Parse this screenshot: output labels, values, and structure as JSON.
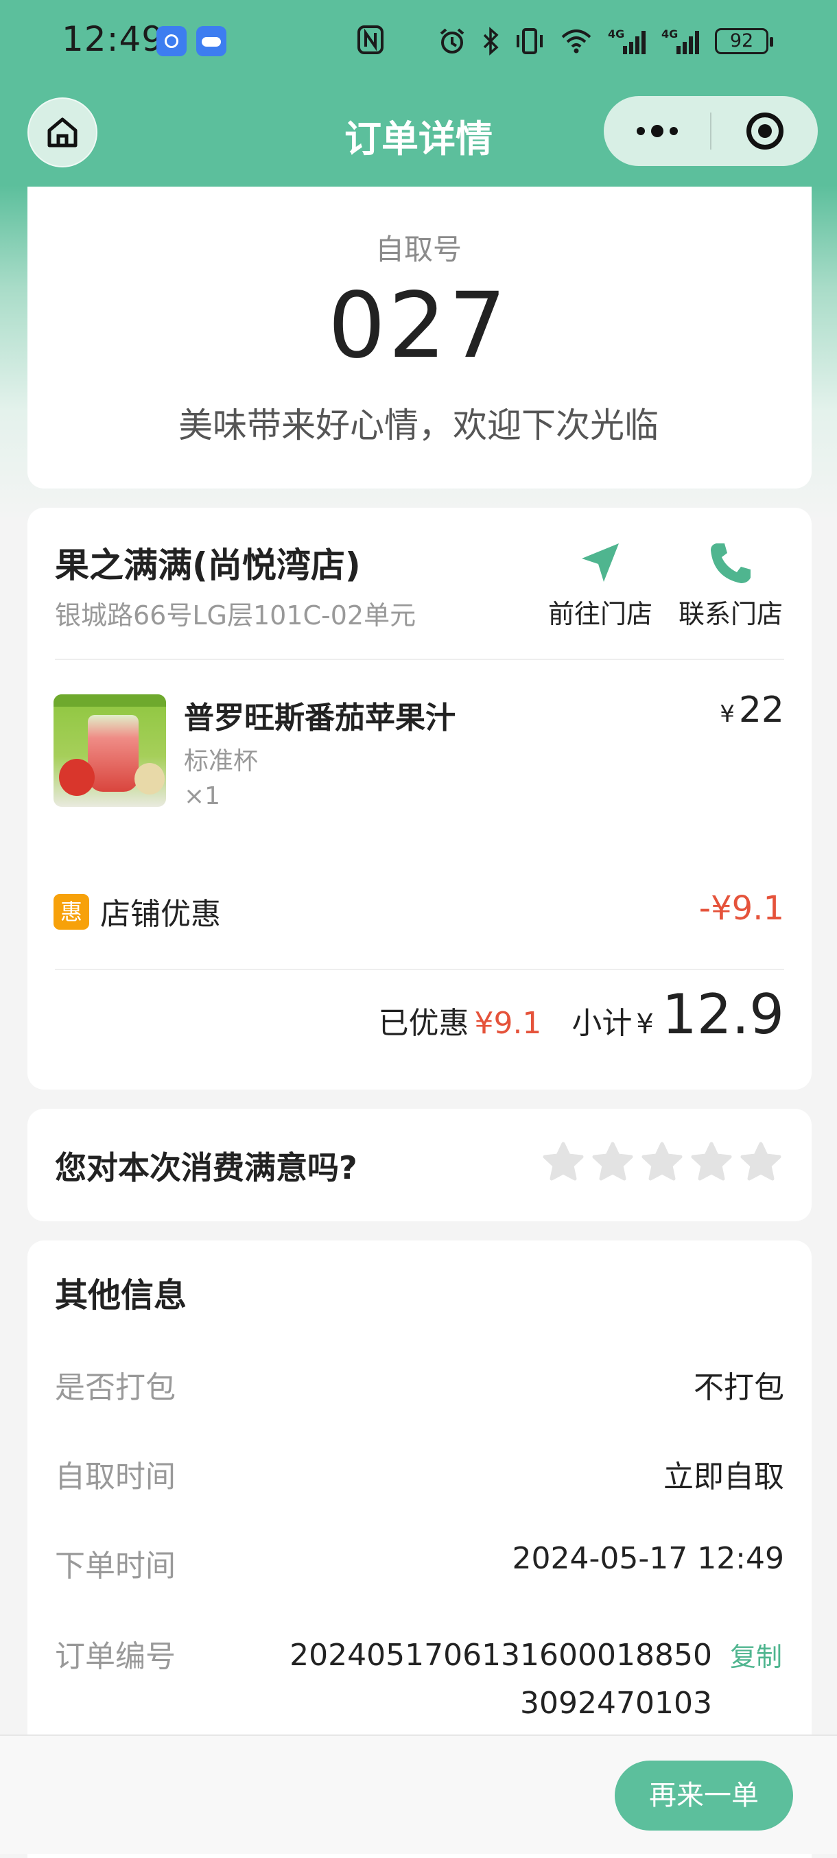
{
  "status_bar": {
    "time": "12:49",
    "battery": "92",
    "icons": [
      "app-icon-1",
      "weather-app-icon",
      "nfc-icon",
      "alarm-icon",
      "bluetooth-icon",
      "vibrate-icon",
      "wifi-icon",
      "signal-4g-icon",
      "signal-4g-icon",
      "battery-icon"
    ]
  },
  "nav": {
    "title": "订单详情"
  },
  "pickup": {
    "label": "自取号",
    "number": "027",
    "slogan": "美味带来好心情，欢迎下次光临"
  },
  "store": {
    "name": "果之满满(尚悦湾店)",
    "address": "银城路66号LG层101C-02单元",
    "navigate_label": "前往门店",
    "contact_label": "联系门店"
  },
  "product": {
    "name": "普罗旺斯番茄苹果汁",
    "spec": "标准杯",
    "qty": "×1",
    "currency": "¥",
    "price": "22"
  },
  "discount": {
    "badge": "惠",
    "label": "店铺优惠",
    "amount": "-¥9.1"
  },
  "summary": {
    "saved_label": "已优惠",
    "saved_amount": "¥9.1",
    "subtotal_label": "小计",
    "currency": "¥",
    "subtotal": "12.9"
  },
  "rating": {
    "question": "您对本次消费满意吗?",
    "stars_max": 5,
    "stars_selected": 0
  },
  "info": {
    "title": "其他信息",
    "rows": [
      {
        "label": "是否打包",
        "value": "不打包"
      },
      {
        "label": "自取时间",
        "value": "立即自取"
      },
      {
        "label": "下单时间",
        "value": "2024-05-17 12:49"
      },
      {
        "label": "订单编号",
        "value": "2024051706131600018850309247010 3"
      }
    ],
    "order_no": "20240517061316000188503092470103",
    "copy_label": "复制"
  },
  "footer": {
    "reorder_label": "再来一单"
  },
  "colors": {
    "brand": "#5cbf9c",
    "accent_red": "#e5533b",
    "badge_orange": "#f7a10a"
  }
}
